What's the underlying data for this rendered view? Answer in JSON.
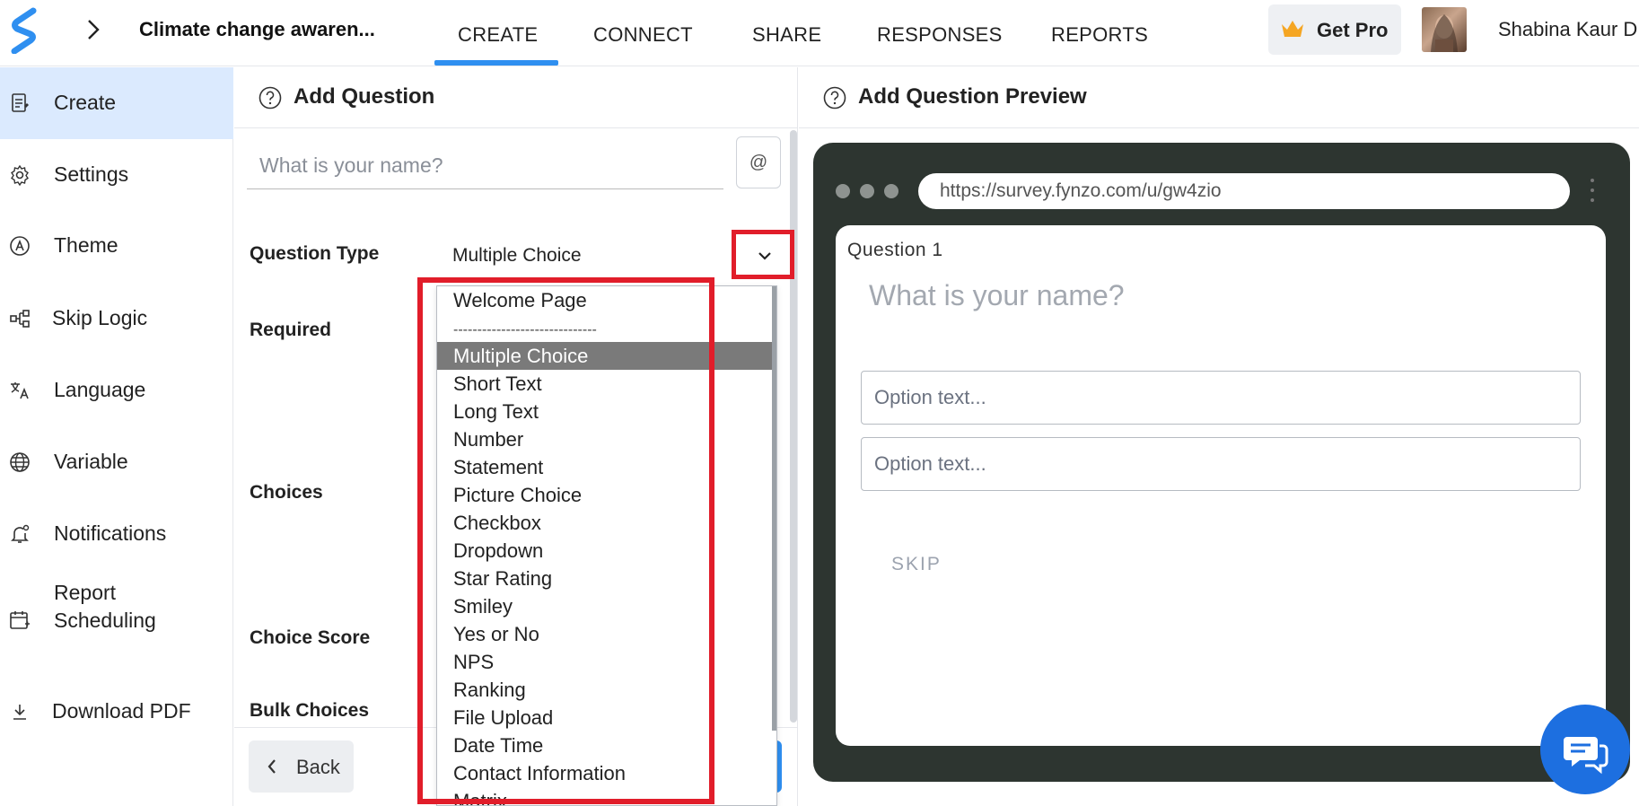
{
  "header": {
    "survey_title": "Climate change awaren...",
    "tabs": [
      {
        "label": "CREATE",
        "active": true
      },
      {
        "label": "CONNECT"
      },
      {
        "label": "SHARE"
      },
      {
        "label": "RESPONSES"
      },
      {
        "label": "REPORTS"
      }
    ],
    "get_pro_label": "Get Pro",
    "user_name": "Shabina Kaur D",
    "accent_color": "#2f8ff0"
  },
  "sidebar": {
    "items": [
      {
        "label": "Create",
        "icon": "create-doc-icon",
        "active": true
      },
      {
        "label": "Settings",
        "icon": "gear-icon"
      },
      {
        "label": "Theme",
        "icon": "theme-icon"
      },
      {
        "label": "Skip Logic",
        "icon": "skip-logic-icon"
      },
      {
        "label": "Language",
        "icon": "translate-icon"
      },
      {
        "label": "Variable",
        "icon": "globe-icon"
      },
      {
        "label": "Notifications",
        "icon": "bell-icon"
      },
      {
        "label": "Report Scheduling",
        "icon": "calendar-icon"
      },
      {
        "label": "Download PDF",
        "icon": "download-icon"
      }
    ]
  },
  "editor": {
    "title": "Add Question",
    "question_placeholder": "What is your name?",
    "at_symbol": "@",
    "labels": {
      "question_type": "Question Type",
      "required": "Required",
      "choices": "Choices",
      "choice_score": "Choice Score",
      "bulk_choices": "Bulk Choices"
    },
    "question_type_value": "Multiple Choice",
    "back_label": "Back"
  },
  "dropdown": {
    "first": "Welcome Page",
    "separator": "------------------------------",
    "options": [
      "Multiple Choice",
      "Short Text",
      "Long Text",
      "Number",
      "Statement",
      "Picture Choice",
      "Checkbox",
      "Dropdown",
      "Star Rating",
      "Smiley",
      "Yes or No",
      "NPS",
      "Ranking",
      "File Upload",
      "Date Time",
      "Contact Information",
      "Matrix"
    ],
    "selected": "Multiple Choice",
    "highlight_color": "#e11d2a"
  },
  "preview": {
    "title": "Add Question Preview",
    "url": "https://survey.fynzo.com/u/gw4zio",
    "question_number": "Question 1",
    "question_text": "What is your name?",
    "options": [
      "Option text...",
      "Option text..."
    ],
    "skip_label": "SKIP"
  }
}
